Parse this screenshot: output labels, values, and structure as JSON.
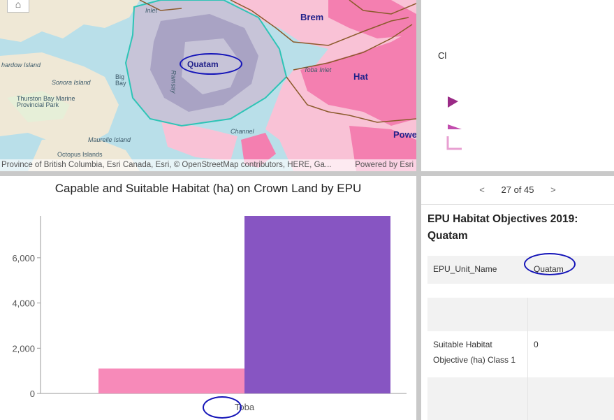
{
  "map": {
    "home_icon": "home-icon",
    "labels": {
      "brem": "Brem",
      "hat": "Hat",
      "powe": "Powe",
      "quatam": "Quatam",
      "inlet": "Inlet",
      "toba_inlet": "Toba Inlet",
      "channel": "Channel",
      "hardow_island": "hardow Island",
      "sonora_island": "Sonora Island",
      "big_bay": "Big\nBay",
      "thurston": "Thurston Bay Marine\nProvincial Park",
      "maurelle": "Maurelle Island",
      "octopus": "Octopus Islands",
      "ramsay": "Ramsay"
    },
    "attribution": "Province of British Columbia, Esri Canada, Esri, © OpenStreetMap contributors, HERE, Ga...",
    "powered_by": "Powered by Esri",
    "colors": {
      "water": "#b9dfe9",
      "land": "#efe8d6",
      "habitat_pink": "#f47fb0",
      "habitat_light": "#f9c2d6",
      "epu_outline": "#2ec4b6",
      "boundary": "#8b5a2b"
    }
  },
  "legend": {
    "line1": "",
    "line2": "Cl",
    "colors": [
      "#9a2a86",
      "#c24dae",
      "#e8a0d2"
    ]
  },
  "chart": {
    "title": "Capable and Suitable Habitat (ha) on Crown Land by EPU",
    "tick_labels": [
      "0",
      "2,000",
      "4,000",
      "6,000"
    ],
    "category_label": "Toba"
  },
  "chart_data": {
    "type": "bar",
    "title": "Capable and Suitable Habitat (ha) on Crown Land by EPU",
    "categories": [
      "Toba"
    ],
    "series": [
      {
        "values": [
          1100
        ],
        "color": "#f78ab9"
      },
      {
        "values": [
          7850
        ],
        "color": "#8755c2"
      }
    ],
    "ylim": [
      0,
      7850
    ],
    "yticks": [
      0,
      2000,
      4000,
      6000
    ],
    "grid": false
  },
  "popup": {
    "prev_icon": "chevron-left-icon",
    "next_icon": "chevron-right-icon",
    "pager_text": "27 of 45",
    "title": "EPU Habitat Objectives 2019: Quatam",
    "rows": [
      {
        "key": "EPU_Unit_Name",
        "value": "Quatam"
      },
      {
        "key": "",
        "value": ""
      },
      {
        "key": "",
        "value": ""
      },
      {
        "key": "Suitable Habitat Objective (ha) Class 1",
        "value": "0"
      },
      {
        "key": "",
        "value": ""
      }
    ]
  }
}
